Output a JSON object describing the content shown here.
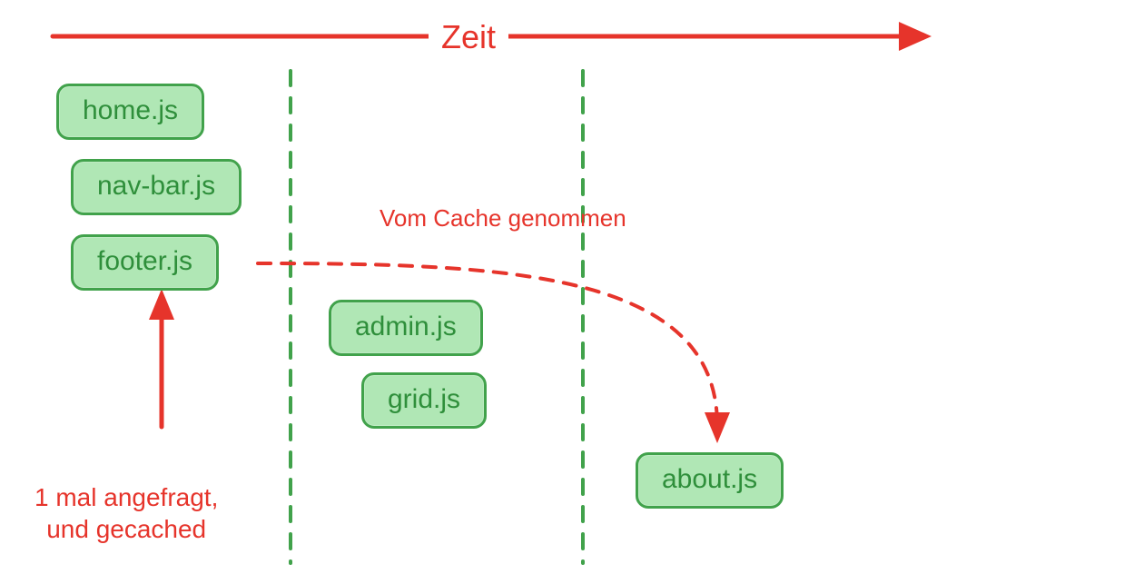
{
  "timeline": {
    "label": "Zeit"
  },
  "column1": {
    "files": [
      "home.js",
      "nav-bar.js",
      "footer.js"
    ],
    "caption": "1 mal angefragt,\nund gecached"
  },
  "column2": {
    "files": [
      "admin.js",
      "grid.js"
    ]
  },
  "column3": {
    "files": [
      "about.js"
    ]
  },
  "cache_label": "Vom Cache genommen"
}
